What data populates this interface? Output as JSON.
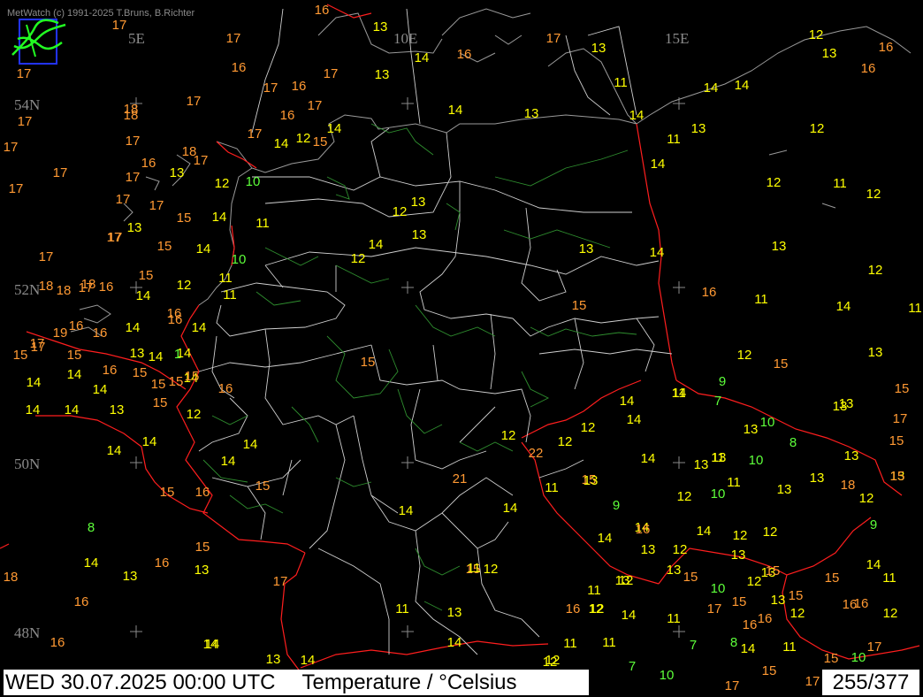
{
  "header": {
    "copyright": "MetWatch  (c) 1991-2025 T.Bruns, B.Richter"
  },
  "footer": {
    "datetime": "WED 30.07.2025 00:00 UTC",
    "title": "Temperature / °Celsius",
    "station_count": "255/377"
  },
  "colors": {
    "background": "#000000",
    "coast": "#9a9a9a",
    "region_border": "#d0d0d0",
    "national_border": "#ff1e1e",
    "forest_border": "#2f8f2f",
    "temp_cool": "#5dff3a",
    "temp_mild": "#ffff00",
    "temp_warm": "#ff9933",
    "grid_label": "#8a8a8a"
  },
  "grid_labels": [
    "5E",
    "10E",
    "15E",
    "54N",
    "52N",
    "50N",
    "48N"
  ],
  "temperature_unit": "°C",
  "temperatures": [
    "17",
    "16",
    "13",
    "17",
    "17",
    "17",
    "16",
    "16",
    "13",
    "14",
    "16",
    "17",
    "13",
    "11",
    "12",
    "13",
    "16",
    "17",
    "17",
    "17",
    "16",
    "17",
    "13",
    "14",
    "16",
    "14",
    "18",
    "17",
    "17",
    "17",
    "14",
    "14",
    "14",
    "13",
    "17",
    "12",
    "14",
    "12",
    "17",
    "17",
    "15",
    "17",
    "17",
    "14",
    "11",
    "12",
    "17",
    "16",
    "18",
    "17",
    "12",
    "10",
    "14",
    "17",
    "13",
    "12",
    "13",
    "13",
    "12",
    "11",
    "16",
    "17",
    "12",
    "11",
    "15",
    "12",
    "11",
    "14",
    "14",
    "17",
    "15",
    "13",
    "14",
    "13",
    "14",
    "13",
    "17",
    "18",
    "15",
    "14",
    "10",
    "12",
    "14",
    "11",
    "16",
    "18",
    "18",
    "18",
    "16",
    "15",
    "12",
    "11",
    "14",
    "16",
    "15",
    "11",
    "14",
    "1",
    "14",
    "16",
    "14",
    "15",
    "17",
    "19",
    "16",
    "16",
    "14",
    "14",
    "15",
    "12",
    "13",
    "15",
    "14",
    "14",
    "13",
    "15",
    "15",
    "14",
    "14",
    "13",
    "16",
    "15",
    "9",
    "14",
    "14",
    "15",
    "17",
    "15",
    "13",
    "15",
    "11",
    "7",
    "15",
    "13",
    "14",
    "12",
    "10",
    "12",
    "15",
    "13",
    "22",
    "12",
    "14",
    "13",
    "13",
    "8",
    "14",
    "14",
    "13",
    "14",
    "13",
    "11",
    "10",
    "15",
    "14",
    "15",
    "21",
    "11",
    "13",
    "11",
    "16",
    "13",
    "13",
    "14",
    "15",
    "14",
    "13",
    "12",
    "10",
    "9",
    "12",
    "8",
    "18",
    "16",
    "14",
    "9",
    "14",
    "12",
    "12",
    "13",
    "14",
    "15",
    "16",
    "18",
    "16",
    "14",
    "12",
    "11",
    "13",
    "15",
    "14",
    "13",
    "17",
    "15",
    "10",
    "12",
    "15",
    "13",
    "13",
    "15",
    "15",
    "12",
    "11",
    "13",
    "16",
    "16",
    "12",
    "11",
    "12",
    "11",
    "13",
    "15",
    "13",
    "11",
    "12",
    "11",
    "12",
    "16",
    "17",
    "14",
    "14",
    "11",
    "7",
    "8",
    "11",
    "16",
    "16",
    "14",
    "12",
    "12",
    "16",
    "14",
    "15",
    "17",
    "13",
    "14",
    "12",
    "7",
    "10",
    "10",
    "15",
    "17",
    "17",
    "14"
  ]
}
